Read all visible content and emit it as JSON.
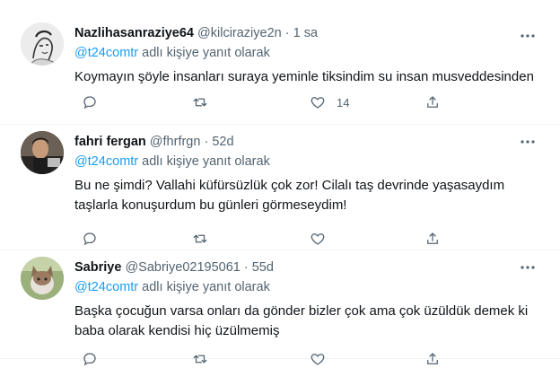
{
  "tweets": [
    {
      "name": "Nazlihasanraziye64",
      "handle": "@kilciraziye2n",
      "time": "1 sa",
      "reply_mention": "@t24comtr",
      "reply_suffix": " adlı kişiye yanıt olarak",
      "text": "Koymayın şöyle insanları suraya yeminle tiksindim su insan musveddesinden",
      "like_count": "14"
    },
    {
      "name": "fahri fergan",
      "handle": "@fhrfrgn",
      "time": "52d",
      "reply_mention": "@t24comtr",
      "reply_suffix": " adlı kişiye yanıt olarak",
      "text": "Bu ne şimdi? Vallahi küfürsüzlük çok zor! Cilalı taş devrinde yaşasaydım taşlarla konuşurdum bu günleri görmeseydim!",
      "like_count": ""
    },
    {
      "name": "Sabriye",
      "handle": "@Sabriye02195061",
      "time": "55d",
      "reply_mention": "@t24comtr",
      "reply_suffix": " adlı kişiye yanıt olarak",
      "text": "Başka çocuğun varsa onları da gönder bizler çok ama çok üzüldük demek ki baba olarak kendisi hiç üzülmemiş",
      "like_count": ""
    }
  ],
  "separator": " · ",
  "icons": {
    "more": "more-horizontal-icon",
    "reply": "reply-bubble-icon",
    "retweet": "retweet-arrows-icon",
    "like": "heart-icon",
    "share": "share-upload-icon"
  },
  "colors": {
    "accent": "#1d9bf0",
    "secondary_text": "#536471",
    "primary_text": "#0f1419",
    "divider": "#eff3f4"
  }
}
